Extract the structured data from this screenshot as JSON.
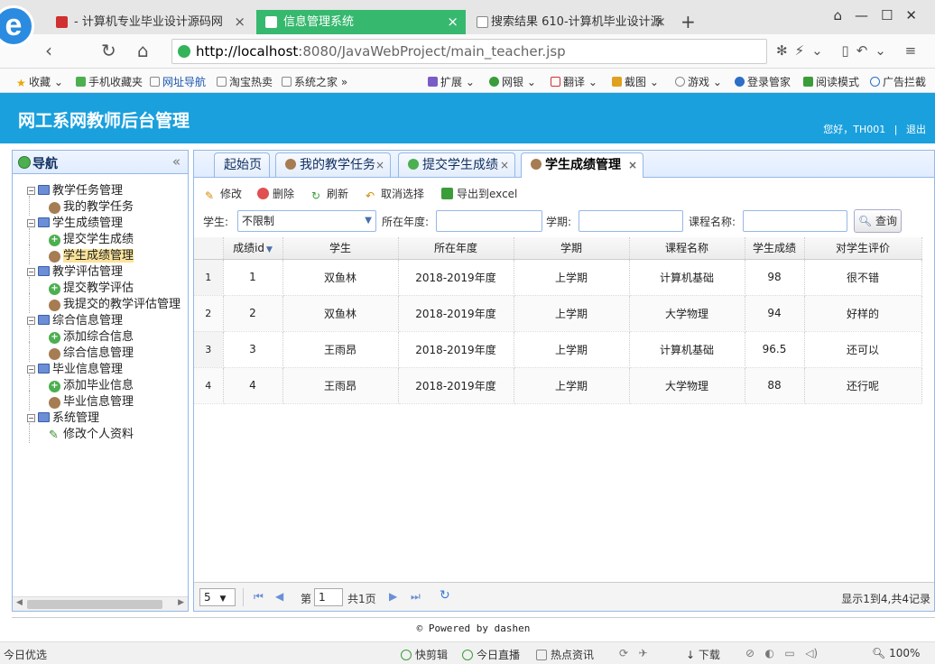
{
  "browser": {
    "tabs": [
      {
        "label": "- 计算机专业毕业设计源码网",
        "color": "#d03030"
      },
      {
        "label": "信息管理系统",
        "color": "#ffffff"
      },
      {
        "label": "搜索结果 610-计算机毕业设计源",
        "color": "#888888"
      }
    ],
    "url_host": "http://localhost",
    "url_path": ":8080/JavaWebProject/main_teacher.jsp",
    "bookmarks": [
      "收藏",
      "手机收藏夹",
      "网址导航",
      "淘宝热卖",
      "系统之家"
    ],
    "ext_tools": [
      "扩展",
      "网银",
      "翻译",
      "截图",
      "游戏",
      "登录管家",
      "阅读模式",
      "广告拦截"
    ]
  },
  "header": {
    "title": "网工系网教师后台管理",
    "user_text": "您好，TH001",
    "logout": "退出"
  },
  "sidebar": {
    "title": "导航",
    "groups": [
      {
        "label": "教学任务管理",
        "items": [
          {
            "label": "我的教学任务",
            "icon": "user"
          }
        ]
      },
      {
        "label": "学生成绩管理",
        "items": [
          {
            "label": "提交学生成绩",
            "icon": "plus"
          },
          {
            "label": "学生成绩管理",
            "icon": "user",
            "selected": true
          }
        ]
      },
      {
        "label": "教学评估管理",
        "items": [
          {
            "label": "提交教学评估",
            "icon": "plus"
          },
          {
            "label": "我提交的教学评估管理",
            "icon": "user"
          }
        ]
      },
      {
        "label": "综合信息管理",
        "items": [
          {
            "label": "添加综合信息",
            "icon": "plus"
          },
          {
            "label": "综合信息管理",
            "icon": "user"
          }
        ]
      },
      {
        "label": "毕业信息管理",
        "items": [
          {
            "label": "添加毕业信息",
            "icon": "plus"
          },
          {
            "label": "毕业信息管理",
            "icon": "user"
          }
        ]
      },
      {
        "label": "系统管理",
        "items": [
          {
            "label": "修改个人资料",
            "icon": "pen"
          }
        ]
      }
    ]
  },
  "content_tabs": [
    {
      "label": "起始页",
      "closable": false,
      "icon": ""
    },
    {
      "label": "我的教学任务",
      "closable": true,
      "icon": "user"
    },
    {
      "label": "提交学生成绩",
      "closable": true,
      "icon": "plus"
    },
    {
      "label": "学生成绩管理",
      "closable": true,
      "icon": "user",
      "active": true
    }
  ],
  "toolbar": {
    "edit": "修改",
    "delete": "删除",
    "refresh": "刷新",
    "cancel_select": "取消选择",
    "export": "导出到excel"
  },
  "filters": {
    "student_label": "学生:",
    "student_value": "不限制",
    "year_label": "所在年度:",
    "term_label": "学期:",
    "course_label": "课程名称:",
    "query": "查询"
  },
  "table": {
    "columns": [
      "成绩id",
      "学生",
      "所在年度",
      "学期",
      "课程名称",
      "学生成绩",
      "对学生评价"
    ],
    "rows": [
      {
        "rn": "1",
        "id": "1",
        "student": "双鱼林",
        "year": "2018-2019年度",
        "term": "上学期",
        "course": "计算机基础",
        "score": "98",
        "comment": "很不错"
      },
      {
        "rn": "2",
        "id": "2",
        "student": "双鱼林",
        "year": "2018-2019年度",
        "term": "上学期",
        "course": "大学物理",
        "score": "94",
        "comment": "好样的"
      },
      {
        "rn": "3",
        "id": "3",
        "student": "王雨昂",
        "year": "2018-2019年度",
        "term": "上学期",
        "course": "计算机基础",
        "score": "96.5",
        "comment": "还可以"
      },
      {
        "rn": "4",
        "id": "4",
        "student": "王雨昂",
        "year": "2018-2019年度",
        "term": "上学期",
        "course": "大学物理",
        "score": "88",
        "comment": "还行呢"
      }
    ]
  },
  "pager": {
    "page_size": "5",
    "page_prefix": "第",
    "page_value": "1",
    "page_total": "共1页",
    "summary": "显示1到4,共4记录"
  },
  "footer": {
    "text": "© Powered by dashen"
  },
  "status": {
    "left": "今日优选",
    "items": [
      "快剪辑",
      "今日直播",
      "热点资讯",
      "下载"
    ],
    "zoom": "100%"
  }
}
